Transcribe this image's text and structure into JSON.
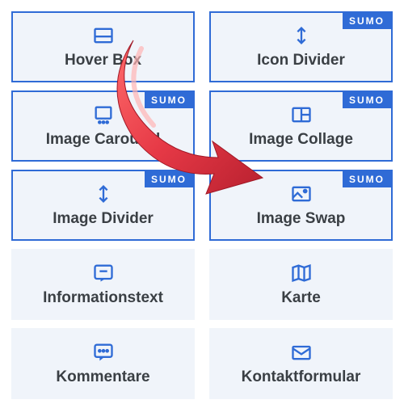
{
  "badge_text": "SUMO",
  "tiles": [
    {
      "label": "Hover Box",
      "icon": "hover-box-icon",
      "sumo": false,
      "outlined": true
    },
    {
      "label": "Icon Divider",
      "icon": "icon-divider-icon",
      "sumo": true,
      "outlined": true
    },
    {
      "label": "Image Carousel",
      "icon": "image-carousel-icon",
      "sumo": true,
      "outlined": true
    },
    {
      "label": "Image Collage",
      "icon": "image-collage-icon",
      "sumo": true,
      "outlined": true
    },
    {
      "label": "Image Divider",
      "icon": "image-divider-icon",
      "sumo": true,
      "outlined": true
    },
    {
      "label": "Image Swap",
      "icon": "image-swap-icon",
      "sumo": true,
      "outlined": true
    },
    {
      "label": "Informationstext",
      "icon": "info-text-icon",
      "sumo": false,
      "outlined": false
    },
    {
      "label": "Karte",
      "icon": "map-icon",
      "sumo": false,
      "outlined": false
    },
    {
      "label": "Kommentare",
      "icon": "comments-icon",
      "sumo": false,
      "outlined": false
    },
    {
      "label": "Kontaktformular",
      "icon": "contact-form-icon",
      "sumo": false,
      "outlined": false
    }
  ]
}
